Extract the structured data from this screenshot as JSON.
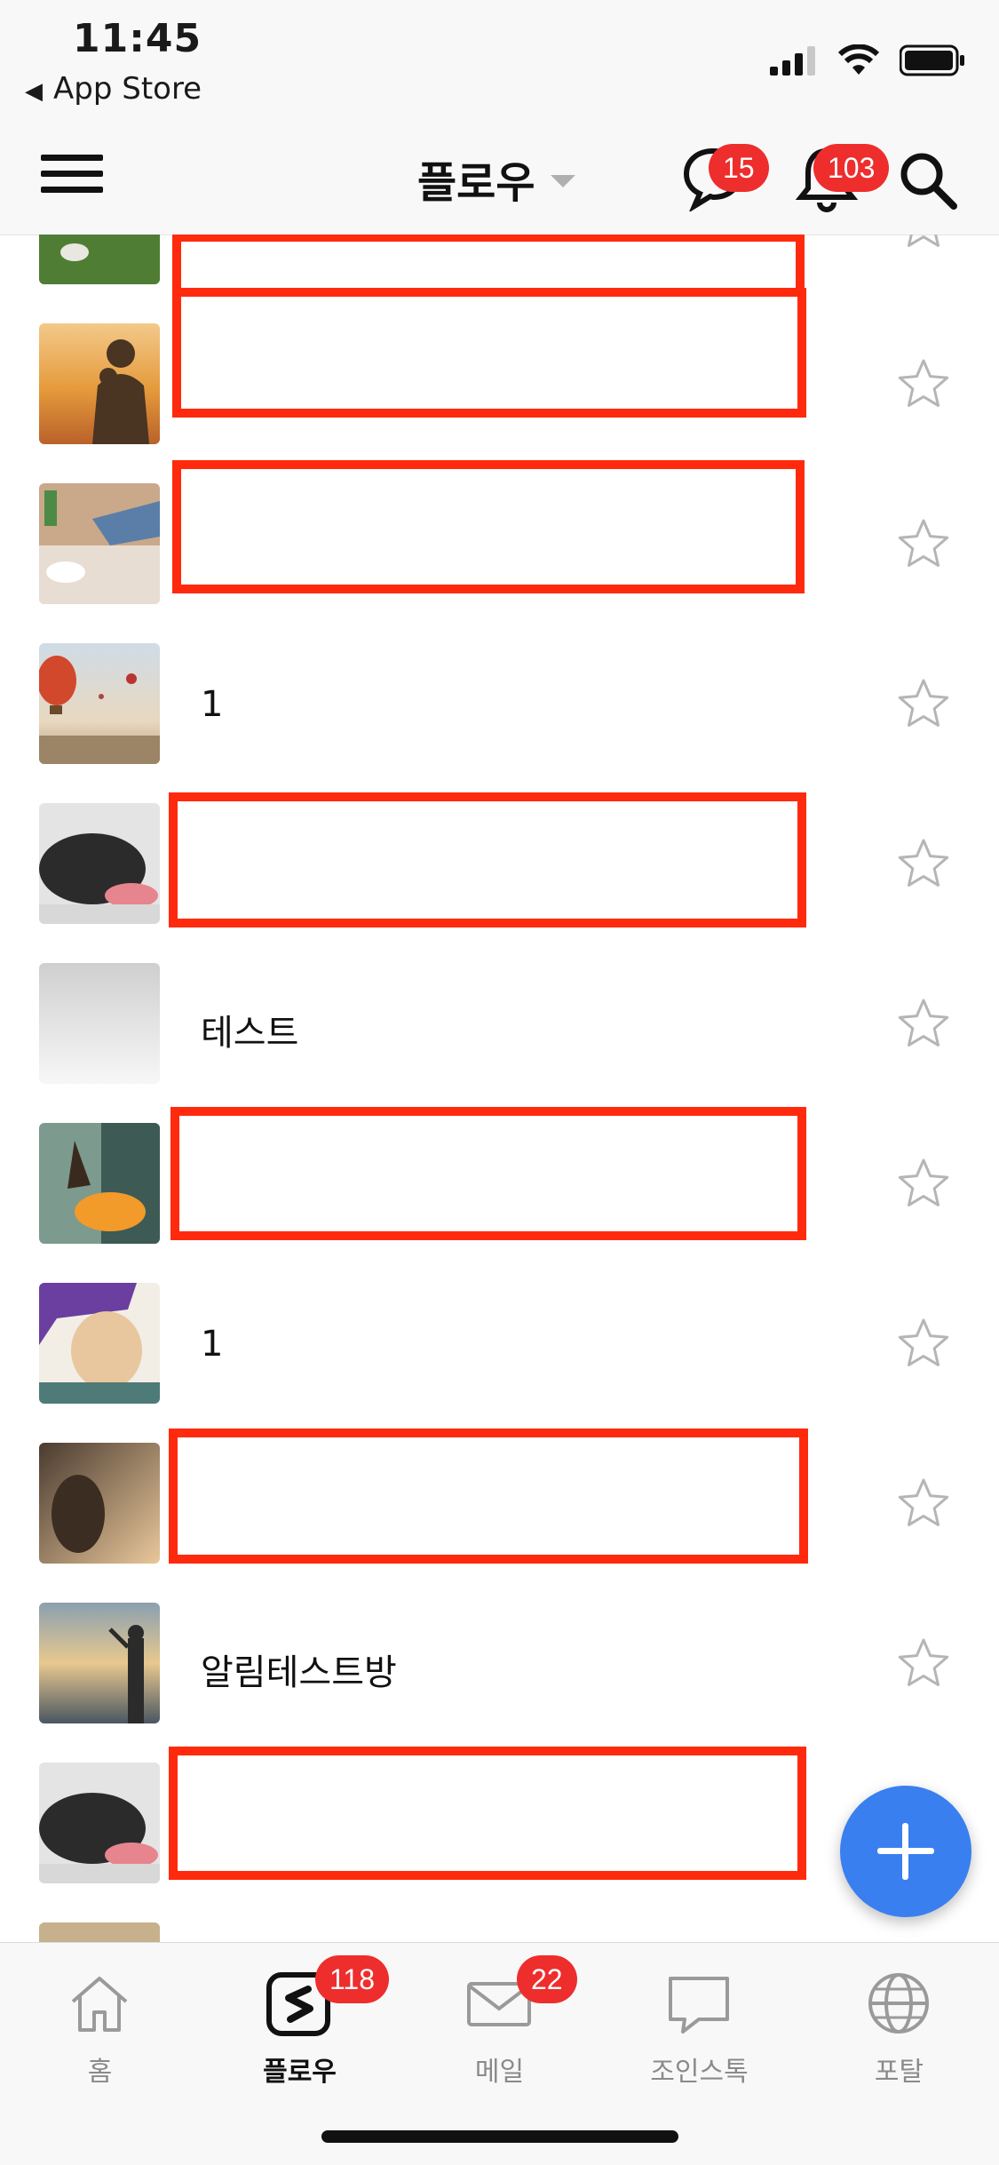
{
  "status_bar": {
    "time": "11:45",
    "back_label": "App Store"
  },
  "header": {
    "title": "플로우",
    "chat_badge": "15",
    "notification_badge": "103"
  },
  "rooms": [
    {
      "name": "",
      "redacted": true
    },
    {
      "name": "",
      "redacted": true
    },
    {
      "name": "",
      "redacted": true
    },
    {
      "name": "1",
      "redacted": false
    },
    {
      "name": "",
      "redacted": true
    },
    {
      "name": "테스트",
      "redacted": false
    },
    {
      "name": "",
      "redacted": true
    },
    {
      "name": "1",
      "redacted": false
    },
    {
      "name": "",
      "redacted": true
    },
    {
      "name": "알림테스트방",
      "redacted": false
    },
    {
      "name": "",
      "redacted": true
    }
  ],
  "tabs": [
    {
      "label": "홈",
      "icon": "home-icon"
    },
    {
      "label": "플로우",
      "icon": "flow-logo-icon",
      "badge": "118",
      "active": true
    },
    {
      "label": "메일",
      "icon": "mail-icon",
      "badge": "22"
    },
    {
      "label": "조인스톡",
      "icon": "chat-bubble-icon"
    },
    {
      "label": "포탈",
      "icon": "globe-icon"
    }
  ],
  "colors": {
    "badge": "#ee2d2d",
    "fab": "#3a7ff0",
    "redaction": "#ff2a0e"
  }
}
